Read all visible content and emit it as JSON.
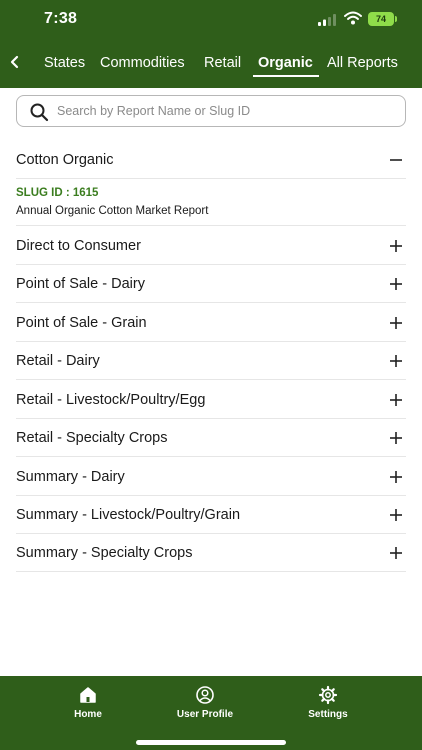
{
  "status_bar": {
    "time": "7:38",
    "battery": "74"
  },
  "tabs": [
    {
      "label": "States",
      "active": false
    },
    {
      "label": "Commodities",
      "active": false
    },
    {
      "label": "Retail",
      "active": false
    },
    {
      "label": "Organic",
      "active": true
    },
    {
      "label": "All Reports",
      "active": false
    }
  ],
  "search": {
    "placeholder": "Search by Report Name or Slug ID"
  },
  "expanded": {
    "label": "Cotton Organic",
    "slug": "SLUG ID : 1615",
    "description": "Annual Organic Cotton Market Report"
  },
  "items": [
    {
      "label": "Direct to Consumer"
    },
    {
      "label": "Point of Sale - Dairy"
    },
    {
      "label": "Point of Sale - Grain"
    },
    {
      "label": "Retail - Dairy"
    },
    {
      "label": "Retail - Livestock/Poultry/Egg"
    },
    {
      "label": "Retail - Specialty Crops"
    },
    {
      "label": "Summary - Dairy"
    },
    {
      "label": "Summary - Livestock/Poultry/Grain"
    },
    {
      "label": "Summary - Specialty Crops"
    }
  ],
  "bottom_nav": [
    {
      "label": "Home",
      "icon": "home-icon"
    },
    {
      "label": "User Profile",
      "icon": "user-icon"
    },
    {
      "label": "Settings",
      "icon": "gear-icon"
    }
  ],
  "colors": {
    "brand_green": "#2f5e1a",
    "slug_green": "#3b7d1f",
    "battery": "#8fdc4a"
  }
}
